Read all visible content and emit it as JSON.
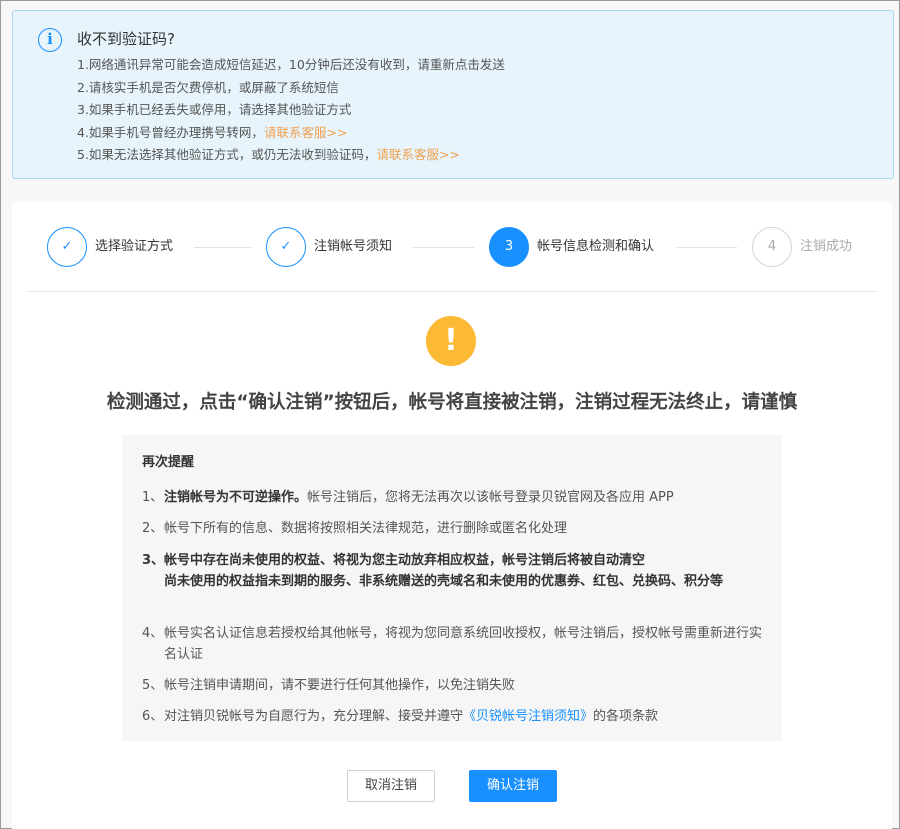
{
  "notice": {
    "title": "收不到验证码?",
    "lines": [
      {
        "text": "1.网络通讯异常可能会造成短信延迟，10分钟后还没有收到，请重新点击发送",
        "link": ""
      },
      {
        "text": "2.请核实手机是否欠费停机，或屏蔽了系统短信",
        "link": ""
      },
      {
        "text": "3.如果手机已经丢失或停用，请选择其他验证方式",
        "link": ""
      },
      {
        "text": "4.如果手机号曾经办理携号转网，",
        "link": "请联系客服>>"
      },
      {
        "text": "5.如果无法选择其他验证方式，或仍无法收到验证码，",
        "link": "请联系客服>>"
      }
    ]
  },
  "steps": [
    {
      "marker": "✓",
      "label": "选择验证方式",
      "state": "done"
    },
    {
      "marker": "✓",
      "label": "注销帐号须知",
      "state": "done"
    },
    {
      "marker": "3",
      "label": "帐号信息检测和确认",
      "state": "active"
    },
    {
      "marker": "4",
      "label": "注销成功",
      "state": "pending"
    }
  ],
  "warning": {
    "icon": "!",
    "headline": "检测通过，点击“确认注销”按钮后，帐号将直接被注销，注销过程无法终止，请谨慎"
  },
  "reminder": {
    "title": "再次提醒",
    "items": [
      {
        "num": "1、",
        "bold": "注销帐号为不可逆操作。",
        "text": "帐号注销后，您将无法再次以该帐号登录贝锐官网及各应用 APP"
      },
      {
        "num": "2、",
        "text": "帐号下所有的信息、数据将按照相关法律规范，进行删除或匿名化处理"
      },
      {
        "num": "3、",
        "bold": "帐号中存在尚未使用的权益、将视为您主动放弃相应权益，帐号注销后将被自动清空",
        "bold2": "尚未使用的权益指未到期的服务、非系统赠送的壳域名和未使用的优惠券、红包、兑换码、积分等"
      },
      {
        "num": "4、",
        "text": "帐号实名认证信息若授权给其他帐号，将视为您同意系统回收授权，帐号注销后，授权帐号需重新进行实名认证"
      },
      {
        "num": "5、",
        "text": "帐号注销申请期间，请不要进行任何其他操作，以免注销失败"
      },
      {
        "num": "6、",
        "text": "对注销贝锐帐号为自愿行为，充分理解、接受并遵守",
        "link": "《贝锐帐号注销须知》",
        "tail": "的各项条款"
      }
    ]
  },
  "buttons": {
    "cancel": "取消注销",
    "confirm": "确认注销"
  },
  "colors": {
    "primary": "#1890ff",
    "warning": "#fbb934",
    "link_orange": "#f0a050"
  }
}
